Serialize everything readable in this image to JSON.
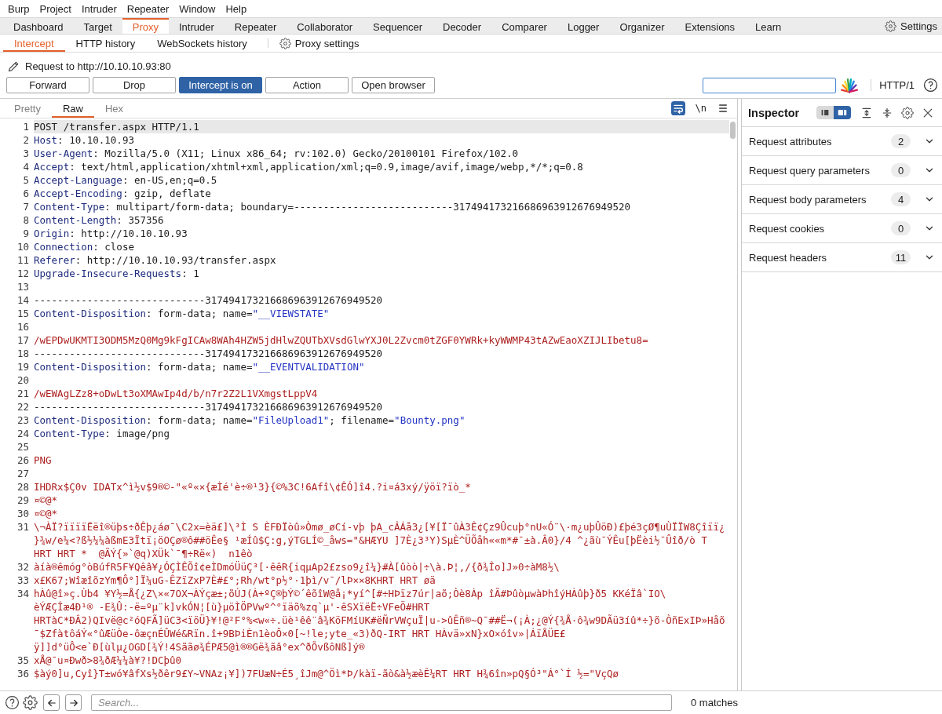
{
  "menu_bar": [
    "Burp",
    "Project",
    "Intruder",
    "Repeater",
    "Window",
    "Help"
  ],
  "main_tabs": [
    {
      "label": "Dashboard",
      "selected": false
    },
    {
      "label": "Target",
      "selected": false
    },
    {
      "label": "Proxy",
      "selected": true
    },
    {
      "label": "Intruder",
      "selected": false
    },
    {
      "label": "Repeater",
      "selected": false
    },
    {
      "label": "Collaborator",
      "selected": false
    },
    {
      "label": "Sequencer",
      "selected": false
    },
    {
      "label": "Decoder",
      "selected": false
    },
    {
      "label": "Comparer",
      "selected": false
    },
    {
      "label": "Logger",
      "selected": false
    },
    {
      "label": "Organizer",
      "selected": false
    },
    {
      "label": "Extensions",
      "selected": false
    },
    {
      "label": "Learn",
      "selected": false
    }
  ],
  "settings": {
    "label": "Settings"
  },
  "proxy_tabs": [
    {
      "label": "Intercept",
      "selected": true
    },
    {
      "label": "HTTP history",
      "selected": false
    },
    {
      "label": "WebSockets history",
      "selected": false
    }
  ],
  "proxy_settings": {
    "label": "Proxy settings"
  },
  "request_target": "Request to http://10.10.10.93:80",
  "toolbar": {
    "buttons": [
      {
        "label": "Forward",
        "on": false
      },
      {
        "label": "Drop",
        "on": false
      },
      {
        "label": "Intercept is on",
        "on": true
      },
      {
        "label": "Action",
        "on": false
      },
      {
        "label": "Open browser",
        "on": false
      }
    ],
    "protocol": "HTTP/1"
  },
  "editor": {
    "view_tabs": [
      {
        "label": "Pretty",
        "selected": false
      },
      {
        "label": "Raw",
        "selected": true
      },
      {
        "label": "Hex",
        "selected": false
      }
    ],
    "wrap_lines": true,
    "newline_toggle": {
      "label": "\\n",
      "on": false
    },
    "lines": [
      {
        "number": "1",
        "selected": true,
        "segments": [
          {
            "kind": "plain",
            "text": "POST /transfer.aspx HTTP/1.1"
          }
        ]
      },
      {
        "number": "2",
        "selected": false,
        "segments": [
          {
            "kind": "key",
            "text": "Host"
          },
          {
            "kind": "plain",
            "text": ": 10.10.10.93"
          }
        ]
      },
      {
        "number": "3",
        "selected": false,
        "segments": [
          {
            "kind": "key",
            "text": "User-Agent"
          },
          {
            "kind": "plain",
            "text": ": Mozilla/5.0 (X11; Linux x86_64; rv:102.0) Gecko/20100101 Firefox/102.0"
          }
        ]
      },
      {
        "number": "4",
        "selected": false,
        "segments": [
          {
            "kind": "key",
            "text": "Accept"
          },
          {
            "kind": "plain",
            "text": ": text/html,application/xhtml+xml,application/xml;q=0.9,image/avif,image/webp,*/*;q=0.8"
          }
        ]
      },
      {
        "number": "5",
        "selected": false,
        "segments": [
          {
            "kind": "key",
            "text": "Accept-Language"
          },
          {
            "kind": "plain",
            "text": ": en-US,en;q=0.5"
          }
        ]
      },
      {
        "number": "6",
        "selected": false,
        "segments": [
          {
            "kind": "key",
            "text": "Accept-Encoding"
          },
          {
            "kind": "plain",
            "text": ": gzip, deflate"
          }
        ]
      },
      {
        "number": "7",
        "selected": false,
        "segments": [
          {
            "kind": "key",
            "text": "Content-Type"
          },
          {
            "kind": "plain",
            "text": ": multipart/form-data; boundary=---------------------------317494173216686963912676949520"
          }
        ]
      },
      {
        "number": "8",
        "selected": false,
        "segments": [
          {
            "kind": "key",
            "text": "Content-Length"
          },
          {
            "kind": "plain",
            "text": ": 357356"
          }
        ]
      },
      {
        "number": "9",
        "selected": false,
        "segments": [
          {
            "kind": "key",
            "text": "Origin"
          },
          {
            "kind": "plain",
            "text": ": http://10.10.10.93"
          }
        ]
      },
      {
        "number": "10",
        "selected": false,
        "segments": [
          {
            "kind": "key",
            "text": "Connection"
          },
          {
            "kind": "plain",
            "text": ": close"
          }
        ]
      },
      {
        "number": "11",
        "selected": false,
        "segments": [
          {
            "kind": "key",
            "text": "Referer"
          },
          {
            "kind": "plain",
            "text": ": http://10.10.10.93/transfer.aspx"
          }
        ]
      },
      {
        "number": "12",
        "selected": false,
        "segments": [
          {
            "kind": "key",
            "text": "Upgrade-Insecure-Requests"
          },
          {
            "kind": "plain",
            "text": ": 1"
          }
        ]
      },
      {
        "number": "13",
        "selected": false
      },
      {
        "number": "14",
        "selected": false,
        "segments": [
          {
            "kind": "plain",
            "text": "-----------------------------317494173216686963912676949520"
          }
        ]
      },
      {
        "number": "15",
        "selected": false,
        "segments": [
          {
            "kind": "key",
            "text": "Content-Disposition"
          },
          {
            "kind": "plain",
            "text": ": form-data; name="
          },
          {
            "kind": "string",
            "text": "\"__VIEWSTATE\""
          }
        ]
      },
      {
        "number": "16",
        "selected": false
      },
      {
        "number": "17",
        "selected": false,
        "segments": [
          {
            "kind": "body",
            "text": "/wEPDwUKMTI3ODM5MzQ0Mg9kFgICAw8WAh4HZW5jdHlwZQUTbXVsdGlwYXJ0L2Zvcm0tZGF0YWRk+kyWWMP43tAZwEaoXZIJLIbetu8="
          }
        ]
      },
      {
        "number": "18",
        "selected": false,
        "segments": [
          {
            "kind": "plain",
            "text": "-----------------------------317494173216686963912676949520"
          }
        ]
      },
      {
        "number": "19",
        "selected": false,
        "segments": [
          {
            "kind": "key",
            "text": "Content-Disposition"
          },
          {
            "kind": "plain",
            "text": ": form-data; name="
          },
          {
            "kind": "string",
            "text": "\"__EVENTVALIDATION\""
          }
        ]
      },
      {
        "number": "20",
        "selected": false
      },
      {
        "number": "21",
        "selected": false,
        "segments": [
          {
            "kind": "body",
            "text": "/wEWAgLZz8+oDwLt3oXMAwIp4d/b/n7r2Z2L1VXmgstLppV4"
          }
        ]
      },
      {
        "number": "22",
        "selected": false,
        "segments": [
          {
            "kind": "plain",
            "text": "-----------------------------317494173216686963912676949520"
          }
        ]
      },
      {
        "number": "23",
        "selected": false,
        "segments": [
          {
            "kind": "key",
            "text": "Content-Disposition"
          },
          {
            "kind": "plain",
            "text": ": form-data; name="
          },
          {
            "kind": "string",
            "text": "\"FileUpload1\""
          },
          {
            "kind": "plain",
            "text": "; filename="
          },
          {
            "kind": "string",
            "text": "\"Bounty.png\""
          }
        ]
      },
      {
        "number": "24",
        "selected": false,
        "segments": [
          {
            "kind": "key",
            "text": "Content-Type"
          },
          {
            "kind": "plain",
            "text": ": image/png"
          }
        ]
      },
      {
        "number": "25",
        "selected": false
      },
      {
        "number": "26",
        "selected": false,
        "segments": [
          {
            "kind": "body",
            "text": "PNG"
          }
        ]
      },
      {
        "number": "27",
        "selected": false
      },
      {
        "number": "28",
        "selected": false,
        "segments": [
          {
            "kind": "body",
            "text": "IHDRx$Ç0v IDATx^ì½v$9®©-\"«º«×{æÌé'è÷®¹3}{©%3C!6Afî\\¢ÊÓ]î4.?i¤á3xý/ÿöï?ïò_*"
          }
        ]
      },
      {
        "number": "29",
        "selected": false,
        "segments": [
          {
            "kind": "body",
            "text": "¤©@*"
          }
        ]
      },
      {
        "number": "30",
        "selected": false,
        "segments": [
          {
            "kind": "body",
            "text": "¤©@*"
          }
        ]
      },
      {
        "number": "31",
        "selected": false,
        "segments": [
          {
            "kind": "body",
            "text": "\\¬ÀÏ?ïïïïËëî®üþs÷ðÊþ¿áø¯\\C2x=èä£]\\³Ì S ÈFÐÏòû»Òmø_øCí-vþ þA_cÂÁå3¿[¥[Ï¯ûÀ3Ê¢Çz9Ûcuþ°nU«Ó¨\\·m¿uþÛöÐ)£þé3çØ¶uÙÏÏW8Çîïï¿\n}¾w/e¼<?ß½¼¼àßmE3Ïtï¡öOÇø®ô##öÊe§ ¹æÍû$Ç:g,ýTGLÍ©_åws=\"&HÆYU ]7È¿3³Y)SµÈ^ÜÕåh««m*#¯±à.Â0}/4 ^¿ãù¯ÝÊu[þËèi½¯Ûîð/ò T\nHRT HRT *  @ÃÝ{»`@q)XÜk`¯¶÷Rë«)  n1êò"
          }
        ]
      },
      {
        "number": "32",
        "selected": false,
        "segments": [
          {
            "kind": "body",
            "text": "àíà®êmóg°òBúfR5F¥Qêâ¥¿ÓÇÌÊÕî¢eÌDmóÜüÇ³[·êêR{iqµAp2£zso9¿î¼}#À[ûòò|÷\\à.Þ¦,/{ð¾Îo]J»0÷àM8½\\"
          }
        ]
      },
      {
        "number": "33",
        "selected": false,
        "segments": [
          {
            "kind": "body",
            "text": "x£K67;WîæîõzYm¶Ô°]Ï¼uG-ÊZïZxP7È#£°;Rh/wt°p½°·1þì/v¯/lÞ××8KHRT HRT øä"
          }
        ]
      },
      {
        "number": "34",
        "selected": false,
        "segments": [
          {
            "kind": "body",
            "text": "hÀû@î»ç.Ùb4 ¥Y½=Å{¿Z\\×«7OX¬ÀÝçæ±;õÚJ(À+ºÇ®þÝ©´êõîW@å¡*yí^[#÷HÞïz7úr|aõ;Òè8Àp îÃ#ÞûòµwàÞhîýHÀûþ}ð5 KKéÏâ`IO\\\nèÝÆÇÎæ4Ð¹® -E¾Û:-ë=ºµ¨k]vkÓN¦[ù}µöÌÖPVwº^°ïäõ%zq`µ'-êSXïëË÷VFeÖ#HRT\nHRTàC*ÐÂ2)QIvë@c²óQFÃ]üC3<ïöÜ}¥!@²F°%<w«÷.üè¹êê¨â¾KöFMíUK#ëÑrVWçuÏ|u->ûÊñ®~Q¯##Ë¬(¡À;¿@Ý{¾Å·ô¾w9DÃü3íû*÷}õ-ÒñExIÞ»Håõ\n¯$ZfàtôáÝ«°ûÆüÒe-ôæçnÉÛWé&Rïn.î+9BÞiÈn1èoÔ×0[~!le;yte_«3)ðQ-IRT HRT HÀvä»xN}xO×óîv»|ÁïÅÜE£\nÿ]]d°üÔ<e`Ð[ùlµ¿OGD[¾Ý!4Sããø¾ÉPÆ5@ì®®Gë¾ãâ°ex^ðÕvßôNß]ý®"
          }
        ]
      },
      {
        "number": "35",
        "selected": false,
        "segments": [
          {
            "kind": "body",
            "text": "xÅ@¯u¤Ðwð>8¾ðÆ¼¼à¥?!DCþû0"
          }
        ]
      },
      {
        "number": "36",
        "selected": false,
        "segments": [
          {
            "kind": "body",
            "text": "$àý0]u,Cyî}T±wó¥âfXs½ðêr9£Y~VNAz¡¥])7FUæN÷É5¸îJm@^Öì*Þ/kàï-ãò&à½æèÊ¼RT HRT H¾6în»pQ§Ó³\"Á°`Í ½=\"VçQø"
          }
        ]
      }
    ]
  },
  "search_bar": {
    "placeholder": "Search...",
    "matches": "0 matches"
  },
  "inspector": {
    "title": "Inspector",
    "layout_options": [
      {
        "selected": false
      },
      {
        "selected": true
      }
    ],
    "sections": [
      {
        "label": "Request attributes",
        "count": "2",
        "expanded": false
      },
      {
        "label": "Request query parameters",
        "count": "0",
        "expanded": false
      },
      {
        "label": "Request body parameters",
        "count": "4",
        "expanded": false
      },
      {
        "label": "Request cookies",
        "count": "0",
        "expanded": false
      },
      {
        "label": "Request headers",
        "count": "11",
        "expanded": false
      }
    ]
  }
}
